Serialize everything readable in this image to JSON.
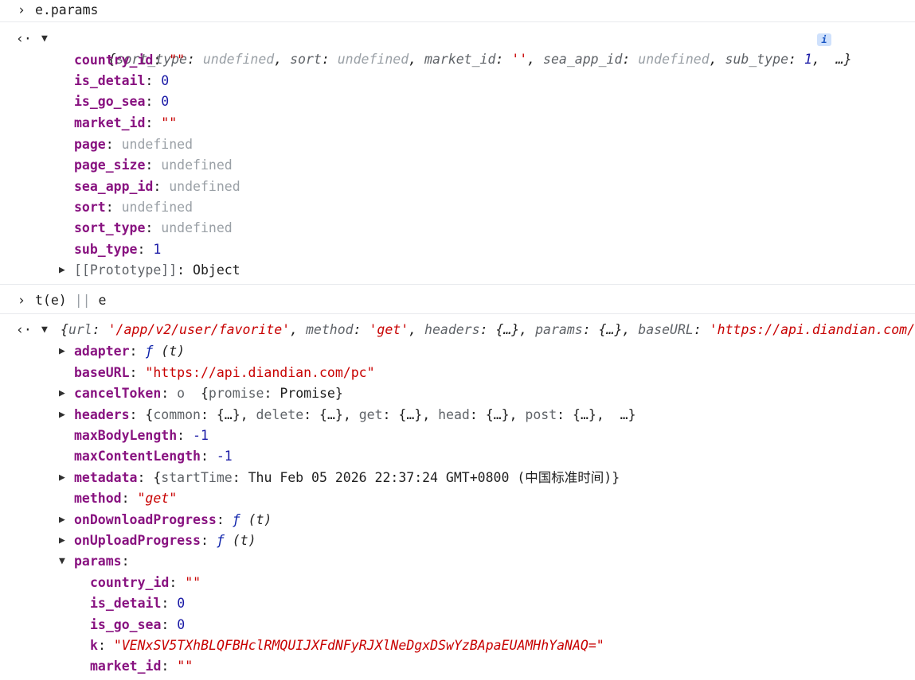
{
  "glyphs": {
    "prompt": "›",
    "result": "‹·",
    "expanded": "▼",
    "collapsed": "▶",
    "info": "i"
  },
  "entry1": {
    "input": "e.params",
    "preview": {
      "open": "{",
      "items": [
        {
          "k": "sort_type",
          "v": "undefined"
        },
        {
          "k": "sort",
          "v": "undefined"
        },
        {
          "k": "market_id",
          "v": "''"
        },
        {
          "k": "sea_app_id",
          "v": "undefined"
        },
        {
          "k": "sub_type",
          "v": "1"
        }
      ],
      "more": "…}"
    },
    "props": [
      {
        "k": "country_id",
        "v": "\"\""
      },
      {
        "k": "is_detail",
        "v": "0"
      },
      {
        "k": "is_go_sea",
        "v": "0"
      },
      {
        "k": "market_id",
        "v": "\"\""
      },
      {
        "k": "page",
        "v": "undefined"
      },
      {
        "k": "page_size",
        "v": "undefined"
      },
      {
        "k": "sea_app_id",
        "v": "undefined"
      },
      {
        "k": "sort",
        "v": "undefined"
      },
      {
        "k": "sort_type",
        "v": "undefined"
      },
      {
        "k": "sub_type",
        "v": "1"
      }
    ],
    "prototype": {
      "k": "[[Prototype]]",
      "v": "Object"
    }
  },
  "entry2": {
    "input_a": "t(e)",
    "input_op": "||",
    "input_b": "e",
    "preview": {
      "url_k": "url",
      "url_v": "'/app/v2/user/favorite'",
      "method_k": "method",
      "method_v": "'get'",
      "headers_k": "headers",
      "headers_v": "{…}",
      "params_k": "params",
      "params_v": "{…}",
      "base_k": "baseURL",
      "base_v": "'https://api.diandian.com/pc'"
    },
    "adapter": {
      "k": "adapter",
      "f": "ƒ",
      "args": "(t)"
    },
    "baseURL": {
      "k": "baseURL",
      "v": "\"https://api.diandian.com/pc\""
    },
    "cancelToken": {
      "k": "cancelToken",
      "cls": "o",
      "pk": "promise",
      "pv": "Promise"
    },
    "headers": {
      "k": "headers",
      "items": [
        {
          "k": "common",
          "v": "{…}"
        },
        {
          "k": "delete",
          "v": "{…}"
        },
        {
          "k": "get",
          "v": "{…}"
        },
        {
          "k": "head",
          "v": "{…}"
        },
        {
          "k": "post",
          "v": "{…}"
        }
      ],
      "more": "…}"
    },
    "maxBodyLength": {
      "k": "maxBodyLength",
      "v": "-1"
    },
    "maxContentLength": {
      "k": "maxContentLength",
      "v": "-1"
    },
    "metadata": {
      "k": "metadata",
      "pk": "startTime",
      "pv": "Thu Feb 05 2026 22:37:24 GMT+0800 (中国标准时间)"
    },
    "method": {
      "k": "method",
      "v": "\"get\""
    },
    "onDownloadProgress": {
      "k": "onDownloadProgress",
      "f": "ƒ",
      "args": "(t)"
    },
    "onUploadProgress": {
      "k": "onUploadProgress",
      "f": "ƒ",
      "args": "(t)"
    },
    "params": {
      "k": "params",
      "items": [
        {
          "k": "country_id",
          "v": "\"\""
        },
        {
          "k": "is_detail",
          "v": "0"
        },
        {
          "k": "is_go_sea",
          "v": "0"
        },
        {
          "k": "k",
          "v": "\"VENxSV5TXhBLQFBHclRMQUIJXFdNFyRJXlNeDgxDSwYzBApaEUAMHhYaNAQ=\""
        },
        {
          "k": "market_id",
          "v": "\"\""
        }
      ]
    }
  }
}
